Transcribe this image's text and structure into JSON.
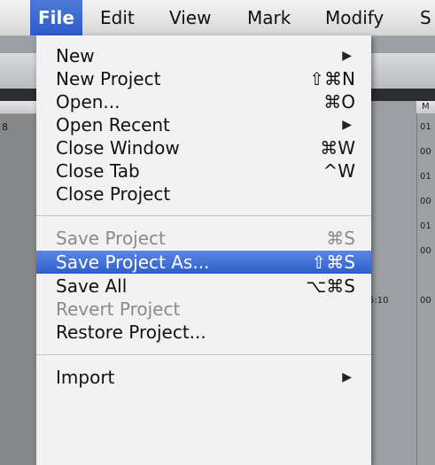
{
  "menubar": {
    "items": [
      {
        "label": "File",
        "active": true
      },
      {
        "label": "Edit"
      },
      {
        "label": "View"
      },
      {
        "label": "Mark"
      },
      {
        "label": "Modify"
      },
      {
        "label": "S"
      }
    ]
  },
  "file_menu": {
    "items": [
      {
        "label": "New",
        "submenu": true
      },
      {
        "label": "New Project",
        "shortcut": "⇧⌘N"
      },
      {
        "label": "Open...",
        "shortcut": "⌘O"
      },
      {
        "label": "Open Recent",
        "submenu": true
      },
      {
        "label": "Close Window",
        "shortcut": "⌘W"
      },
      {
        "label": "Close Tab",
        "shortcut": "^W"
      },
      {
        "label": "Close Project"
      },
      {
        "label": "Save Project",
        "shortcut": "⌘S",
        "disabled": true
      },
      {
        "label": "Save Project As...",
        "shortcut": "⇧⌘S",
        "highlighted": true
      },
      {
        "label": "Save All",
        "shortcut": "⌥⌘S"
      },
      {
        "label": "Revert Project",
        "disabled": true
      },
      {
        "label": "Restore Project..."
      },
      {
        "label": "Import",
        "submenu": true
      }
    ],
    "submenu_arrow": "▶"
  },
  "background": {
    "left_row_number": "8",
    "right_column_header": "M",
    "right_column_values": [
      "01",
      "00",
      "01",
      "00",
      "01",
      "00",
      "00"
    ],
    "timecode": "5:10"
  },
  "colors": {
    "highlight": "#3a68d4",
    "menu_background": "#f2f2f2",
    "disabled_text": "#8a8a8a"
  }
}
